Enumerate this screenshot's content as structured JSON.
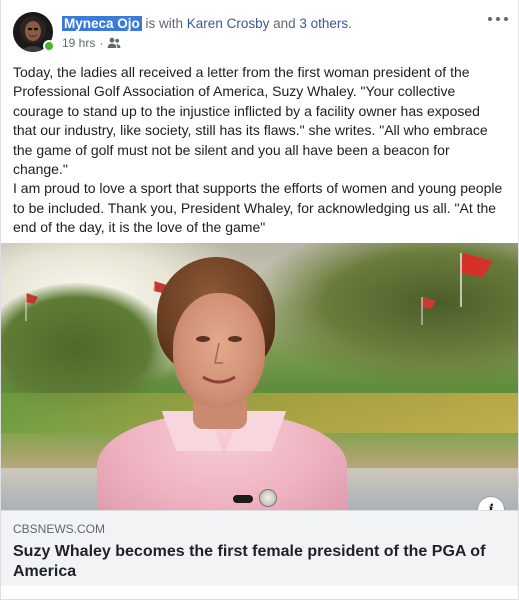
{
  "post": {
    "author": "Myneca Ojo",
    "with_text": " is with ",
    "tagged_person": "Karen Crosby",
    "and_text": " and ",
    "others_text": "3 others",
    "end_text": ".",
    "timestamp": "19 hrs",
    "separator": "·",
    "audience_icon": "friends-icon",
    "more_icon": "more-options-icon",
    "paragraphs": [
      "Today, the ladies all received a letter from the first woman president of the Professional Golf Association of America, Suzy Whaley. \"Your collective courage to stand up to the injustice inflicted by a facility owner has exposed that our industry, like society, still has its flaws.\" she writes. \"All who embrace the game of golf must not be silent and you all have been a beacon for change.\"",
      "I am proud to love a sport that supports the efforts of women and young people to be included. Thank you, President Whaley, for acknowledging us all. \"At the end of the day, it is the love of the game\""
    ]
  },
  "link_preview": {
    "domain": "CBSNEWS.COM",
    "title": "Suzy Whaley becomes the first female president of the PGA of America",
    "info_label": "i"
  },
  "colors": {
    "author_highlight": "#3b7bd8",
    "online_status": "#42b72a",
    "link_bg": "#f2f3f5",
    "secondary_text": "#606770"
  }
}
